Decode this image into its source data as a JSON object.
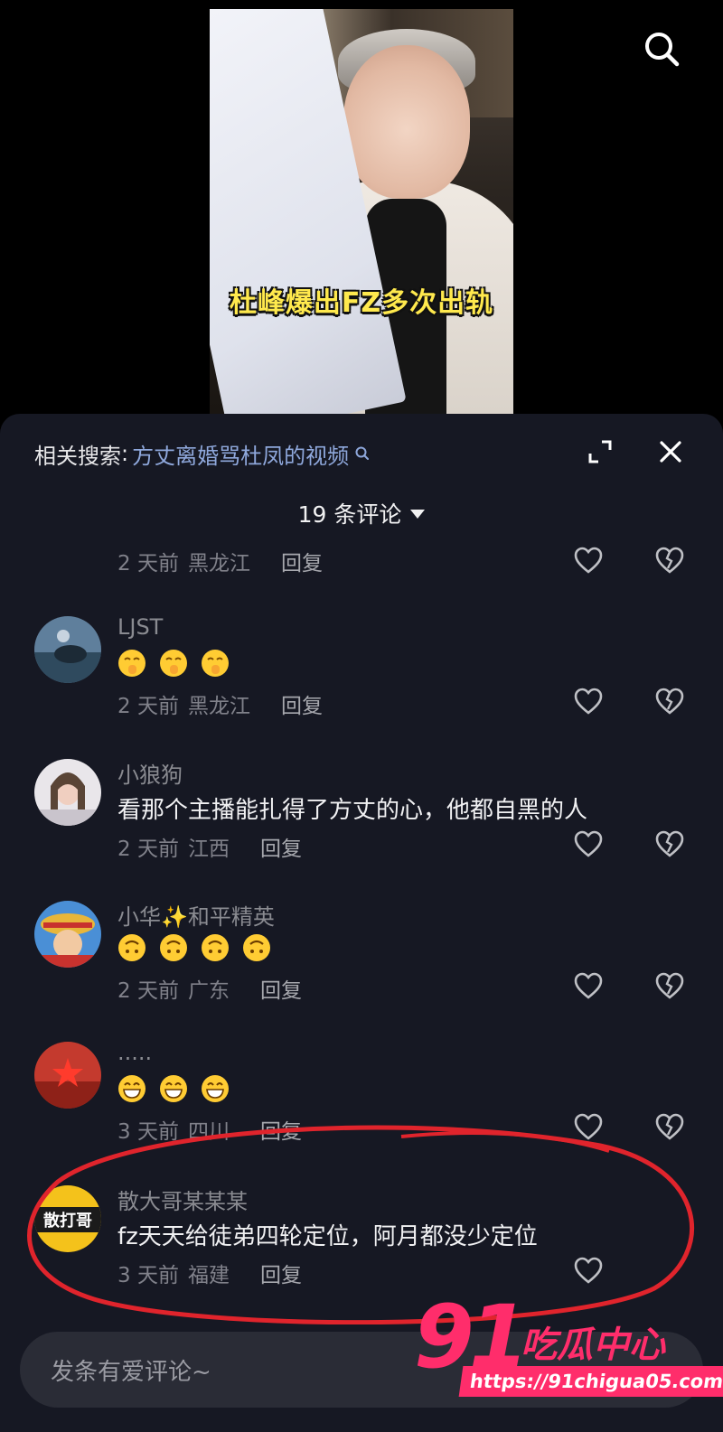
{
  "video": {
    "caption": "杜峰爆出FZ多次出轨"
  },
  "related_search": {
    "label": "相关搜索",
    "colon": ":",
    "term": "方丈离婚骂杜凤的视频"
  },
  "comments_header": {
    "count_label": "19 条评论"
  },
  "comments": [
    {
      "user": "",
      "text": "",
      "time": "2 天前",
      "location": "黑龙江",
      "reply": "回复"
    },
    {
      "user": "LJST",
      "text": "",
      "emojis": 3,
      "emoji_kind": "shush",
      "time": "2 天前",
      "location": "黑龙江",
      "reply": "回复"
    },
    {
      "user": "小狼狗",
      "text": "看那个主播能扎得了方丈的心，他都自黑的人",
      "time": "2 天前",
      "location": "江西",
      "reply": "回复"
    },
    {
      "user": "小华✨和平精英",
      "text": "",
      "emojis": 4,
      "emoji_kind": "upside-down",
      "time": "2 天前",
      "location": "广东",
      "reply": "回复"
    },
    {
      "user": ".....",
      "text": "",
      "emojis": 3,
      "emoji_kind": "grin",
      "time": "3 天前",
      "location": "四川",
      "reply": "回复"
    },
    {
      "user": "散大哥某某某",
      "text": "fz天天给徒弟四轮定位，阿月都没少定位",
      "time": "3 天前",
      "location": "福建",
      "reply": "回复",
      "avatar_text": "散打哥"
    }
  ],
  "input": {
    "placeholder": "发条有爱评论~"
  },
  "watermark": {
    "number": "91",
    "name": "吃瓜中心",
    "url": "https://91chigua05.com"
  },
  "colors": {
    "panel_bg": "#161823",
    "link": "#8fa8dc",
    "highlight": "#e0242c",
    "watermark": "#ff2d6b"
  }
}
